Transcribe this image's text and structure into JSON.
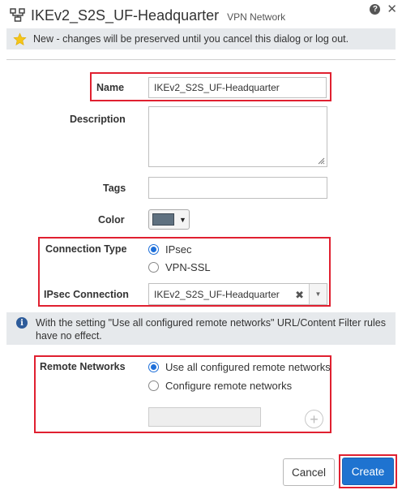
{
  "header": {
    "title": "IKEv2_S2S_UF-Headquarter",
    "subtitle": "VPN Network",
    "help_glyph": "?",
    "close_glyph": "✕"
  },
  "notice": {
    "text": "New - changes will be preserved until you cancel this dialog or log out."
  },
  "form": {
    "name_label": "Name",
    "name_value": "IKEv2_S2S_UF-Headquarter",
    "description_label": "Description",
    "description_value": "",
    "tags_label": "Tags",
    "tags_value": "",
    "color_label": "Color",
    "color_value": "#5f7180",
    "connection_type_label": "Connection Type",
    "connection_type_options": [
      "IPsec",
      "VPN-SSL"
    ],
    "connection_type_selected": "IPsec",
    "ipsec_connection_label": "IPsec Connection",
    "ipsec_connection_value": "IKEv2_S2S_UF-Headquarter",
    "remote_networks_label": "Remote Networks",
    "remote_networks_options": [
      "Use all configured remote networks",
      "Configure remote networks"
    ],
    "remote_networks_selected": "Use all configured remote networks"
  },
  "info": {
    "text": "With the setting \"Use all configured remote networks\" URL/Content Filter rules have no effect."
  },
  "buttons": {
    "cancel": "Cancel",
    "create": "Create"
  },
  "colors": {
    "highlight": "#e02030",
    "accent": "#1e73d0",
    "star": "#f5c518"
  }
}
